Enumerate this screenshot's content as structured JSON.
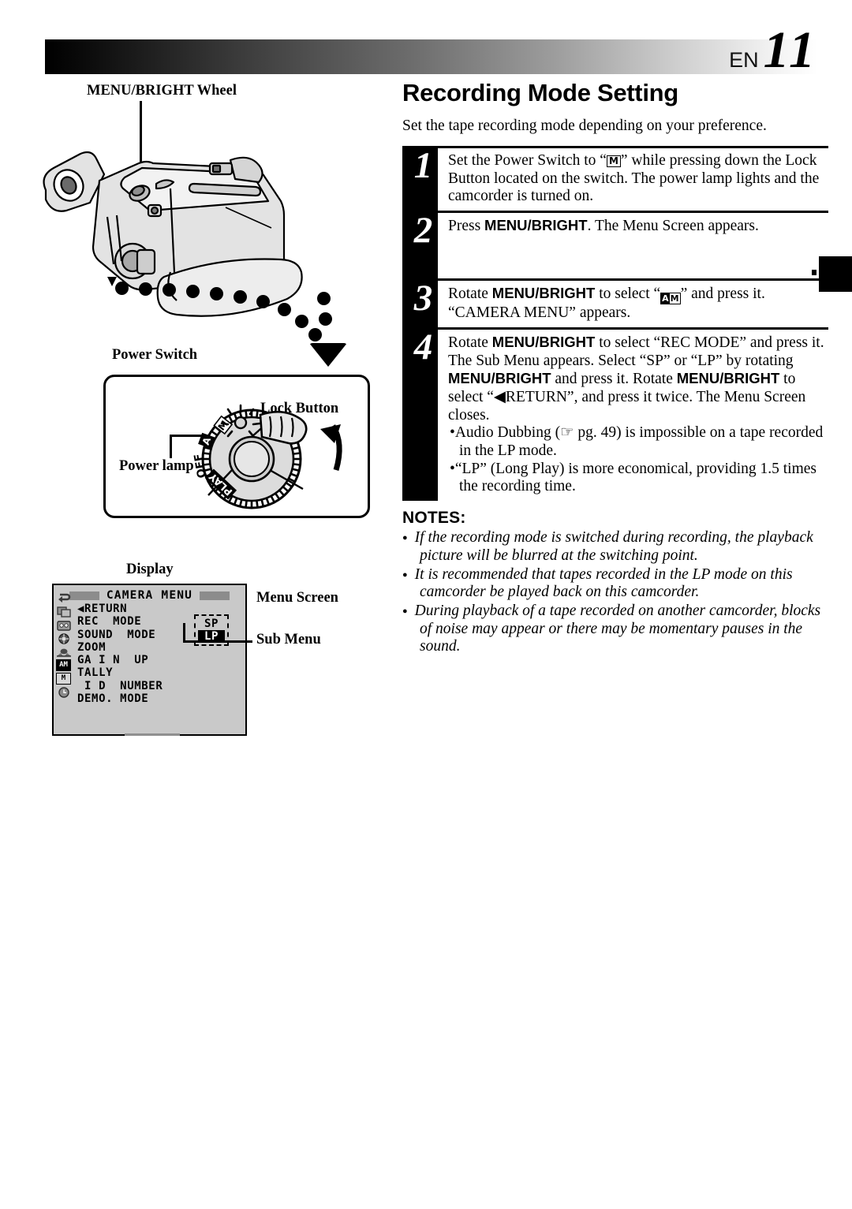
{
  "header": {
    "lang_code": "EN",
    "page_number": "11"
  },
  "left_figure": {
    "menu_wheel_label": "MENU/BRIGHT Wheel",
    "power_switch_label": "Power Switch",
    "lock_button_label": "Lock Button",
    "power_lamp_label": "Power lamp",
    "dial_positions": [
      "PLAY",
      "OFF",
      "A",
      "M"
    ],
    "display_label": "Display",
    "menu_screen_label": "Menu Screen",
    "sub_menu_label": "Sub Menu"
  },
  "menu_screen": {
    "title": "CAMERA  MENU",
    "icons": [
      "return-icon",
      "copy-icon",
      "cassette-icon",
      "aperture-icon",
      "landscape-icon",
      "AM",
      "M",
      "clock-icon"
    ],
    "items": [
      {
        "label": "◀RETURN",
        "selected": false
      },
      {
        "label": "REC  MODE",
        "selected": true
      },
      {
        "label": "SOUND  MODE",
        "selected": false
      },
      {
        "label": "ZOOM",
        "selected": false
      },
      {
        "label": "GA I N  UP",
        "selected": false
      },
      {
        "label": "TALLY",
        "selected": false
      },
      {
        "label": " I D  NUMBER",
        "selected": false
      },
      {
        "label": "DEMO. MODE",
        "selected": false
      }
    ],
    "sub_menu_options": [
      {
        "label": "SP",
        "selected": false
      },
      {
        "label": "LP",
        "selected": true
      }
    ]
  },
  "main": {
    "title": "Recording Mode Setting",
    "intro": "Set the tape recording mode depending on your preference.",
    "steps": [
      {
        "number": "1",
        "text_before": "Set the Power Switch to “",
        "glyph": "M",
        "text_after": "” while pressing down the Lock Button located on the switch. The power lamp lights and the camcorder is turned on."
      },
      {
        "number": "2",
        "text_before": "Press ",
        "bold": "MENU/BRIGHT",
        "text_after": ". The Menu Screen appears."
      },
      {
        "number": "3",
        "text_before": "Rotate ",
        "bold": "MENU/BRIGHT",
        "text_mid": " to select “",
        "glyph": "AM",
        "text_after": "” and press it. “CAMERA MENU” appears."
      },
      {
        "number": "4",
        "text": "Rotate MENU/BRIGHT to select “REC MODE” and press it. The Sub Menu appears. Select “SP” or “LP” by rotating MENU/BRIGHT and press it. Rotate MENU/BRIGHT to select “◀RETURN”, and press it twice. The Menu Screen closes.",
        "bullets": [
          "Audio Dubbing (☞ pg. 49) is impossible on a tape recorded in the LP mode.",
          "“LP” (Long Play) is more economical, providing 1.5 times the recording time."
        ]
      }
    ]
  },
  "notes": {
    "heading": "NOTES:",
    "items": [
      "If the recording mode is switched during recording, the playback picture will be blurred at the switching point.",
      "It is recommended that tapes recorded in the LP mode on this camcorder be played back on this camcorder.",
      "During playback of a tape recorded on another camcorder, blocks of noise may appear or there may be momentary pauses in the sound."
    ]
  }
}
